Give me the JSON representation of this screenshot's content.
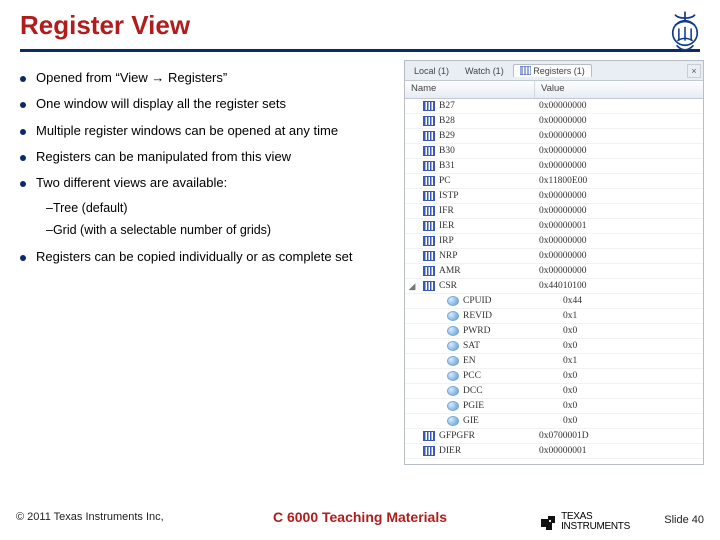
{
  "title": "Register View",
  "bullets": [
    "Opened from “View → Registers”",
    "One window will display all the register sets",
    "Multiple register windows can be opened at any time",
    "Registers can be manipulated from this view",
    "Two different views are available:"
  ],
  "subs": [
    "–Tree (default)",
    "–Grid (with a selectable number of grids)"
  ],
  "bullet_last": "Registers can be copied individually or as complete set",
  "panel": {
    "tabs": [
      "Local (1)",
      "Watch (1)"
    ],
    "active_tab": "Registers (1)",
    "close": "×",
    "col_name": "Name",
    "col_value": "Value"
  },
  "regs": [
    {
      "t": "reg",
      "n": "B27",
      "v": "0x00000000"
    },
    {
      "t": "reg",
      "n": "B28",
      "v": "0x00000000"
    },
    {
      "t": "reg",
      "n": "B29",
      "v": "0x00000000"
    },
    {
      "t": "reg",
      "n": "B30",
      "v": "0x00000000"
    },
    {
      "t": "reg",
      "n": "B31",
      "v": "0x00000000"
    },
    {
      "t": "reg",
      "n": "PC",
      "v": "0x11800E00"
    },
    {
      "t": "reg",
      "n": "ISTP",
      "v": "0x00000000"
    },
    {
      "t": "reg",
      "n": "IFR",
      "v": "0x00000000"
    },
    {
      "t": "reg",
      "n": "IER",
      "v": "0x00000001"
    },
    {
      "t": "reg",
      "n": "IRP",
      "v": "0x00000000"
    },
    {
      "t": "reg",
      "n": "NRP",
      "v": "0x00000000"
    },
    {
      "t": "reg",
      "n": "AMR",
      "v": "0x00000000"
    },
    {
      "t": "csr",
      "n": "CSR",
      "v": "0x44010100"
    },
    {
      "t": "bit",
      "n": "CPUID",
      "v": "0x44"
    },
    {
      "t": "bit",
      "n": "REVID",
      "v": "0x1"
    },
    {
      "t": "bit",
      "n": "PWRD",
      "v": "0x0"
    },
    {
      "t": "bit",
      "n": "SAT",
      "v": "0x0"
    },
    {
      "t": "bit",
      "n": "EN",
      "v": "0x1"
    },
    {
      "t": "bit",
      "n": "PCC",
      "v": "0x0"
    },
    {
      "t": "bit",
      "n": "DCC",
      "v": "0x0"
    },
    {
      "t": "bit",
      "n": "PGIE",
      "v": "0x0"
    },
    {
      "t": "bit",
      "n": "GIE",
      "v": "0x0"
    },
    {
      "t": "reg",
      "n": "GFPGFR",
      "v": "0x0700001D"
    },
    {
      "t": "reg",
      "n": "DIER",
      "v": "0x00000001"
    }
  ],
  "footer": {
    "copyright": "© 2011 Texas Instruments Inc,",
    "center": "C 6000 Teaching Materials",
    "ti": "TEXAS INSTRUMENTS",
    "slide": "Slide 40"
  }
}
